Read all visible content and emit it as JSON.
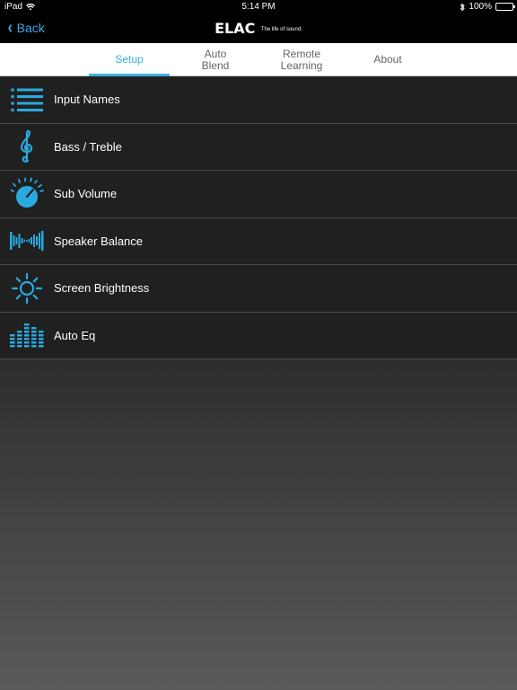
{
  "status_bar": {
    "carrier": "iPad",
    "time": "5:14 PM",
    "battery_percent": "100%"
  },
  "nav": {
    "back_label": "Back",
    "logo_brand": "ELAC",
    "logo_tagline": "The life of sound."
  },
  "tabs": [
    {
      "label_line1": "Setup",
      "label_line2": ""
    },
    {
      "label_line1": "Auto",
      "label_line2": "Blend"
    },
    {
      "label_line1": "Remote",
      "label_line2": "Learning"
    },
    {
      "label_line1": "About",
      "label_line2": ""
    }
  ],
  "menu": {
    "items": [
      {
        "label": "Input Names",
        "icon": "list-icon"
      },
      {
        "label": "Bass / Treble",
        "icon": "treble-clef-icon"
      },
      {
        "label": "Sub Volume",
        "icon": "volume-knob-icon"
      },
      {
        "label": "Speaker Balance",
        "icon": "waveform-icon"
      },
      {
        "label": "Screen Brightness",
        "icon": "sun-icon"
      },
      {
        "label": "Auto Eq",
        "icon": "equalizer-icon"
      }
    ]
  },
  "colors": {
    "accent": "#3ab0e0",
    "icon": "#29a9e0",
    "battery": "#4cd964"
  }
}
